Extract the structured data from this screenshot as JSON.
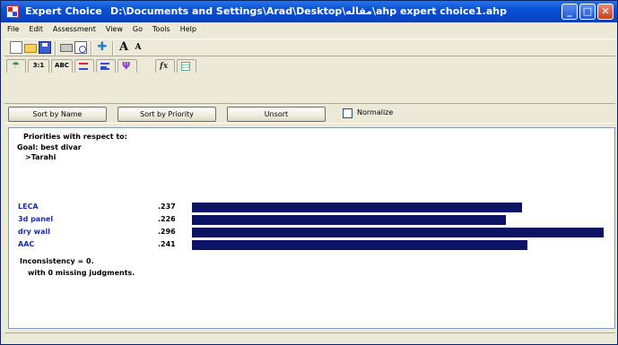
{
  "window": {
    "app_title": "Expert Choice",
    "file_path": "D:\\Documents and Settings\\Arad\\Desktop\\مقاله\\ahp expert choice1.ahp",
    "minimize_glyph": "_",
    "maximize_glyph": "□",
    "close_glyph": "✕"
  },
  "menu": [
    "File",
    "Edit",
    "Assessment",
    "View",
    "Go",
    "Tools",
    "Help"
  ],
  "toolbar": {
    "icons": [
      "new-icon",
      "open-icon",
      "save-icon",
      "print-icon",
      "print-preview-icon",
      "cross-icon",
      "font-larger-icon",
      "font-smaller-icon"
    ],
    "font_large": "A",
    "font_small": "A",
    "cross": "✚"
  },
  "tabs": [
    {
      "name": "tree-icon",
      "glyph": "☂"
    },
    {
      "label": "3:1"
    },
    {
      "label": "ABC"
    },
    {
      "name": "bars-icon"
    },
    {
      "name": "lines-icon"
    },
    {
      "name": "fork-icon",
      "glyph": "Ψ"
    },
    {
      "name": "fx-icon",
      "glyph": "fx"
    },
    {
      "name": "grid-icon"
    }
  ],
  "sortbar": {
    "sort_by_name": "Sort by Name",
    "sort_by_priority": "Sort by Priority",
    "unsort": "Unsort",
    "normalize": "Normalize"
  },
  "results": {
    "heading": "Priorities with respect to:",
    "goal": "Goal: best divar",
    "path": ">Tarahi",
    "inconsistency": "Inconsistency = 0.",
    "missing": "with 0  missing judgments."
  },
  "chart_data": {
    "type": "bar",
    "orientation": "horizontal",
    "categories": [
      "LECA",
      "3d panel",
      "dry wall",
      "AAC"
    ],
    "values": [
      0.237,
      0.226,
      0.296,
      0.241
    ],
    "labels": [
      ".237",
      ".226",
      ".296",
      ".241"
    ],
    "bar_color": "#0c1363",
    "label_color": "#1a2bc0"
  }
}
